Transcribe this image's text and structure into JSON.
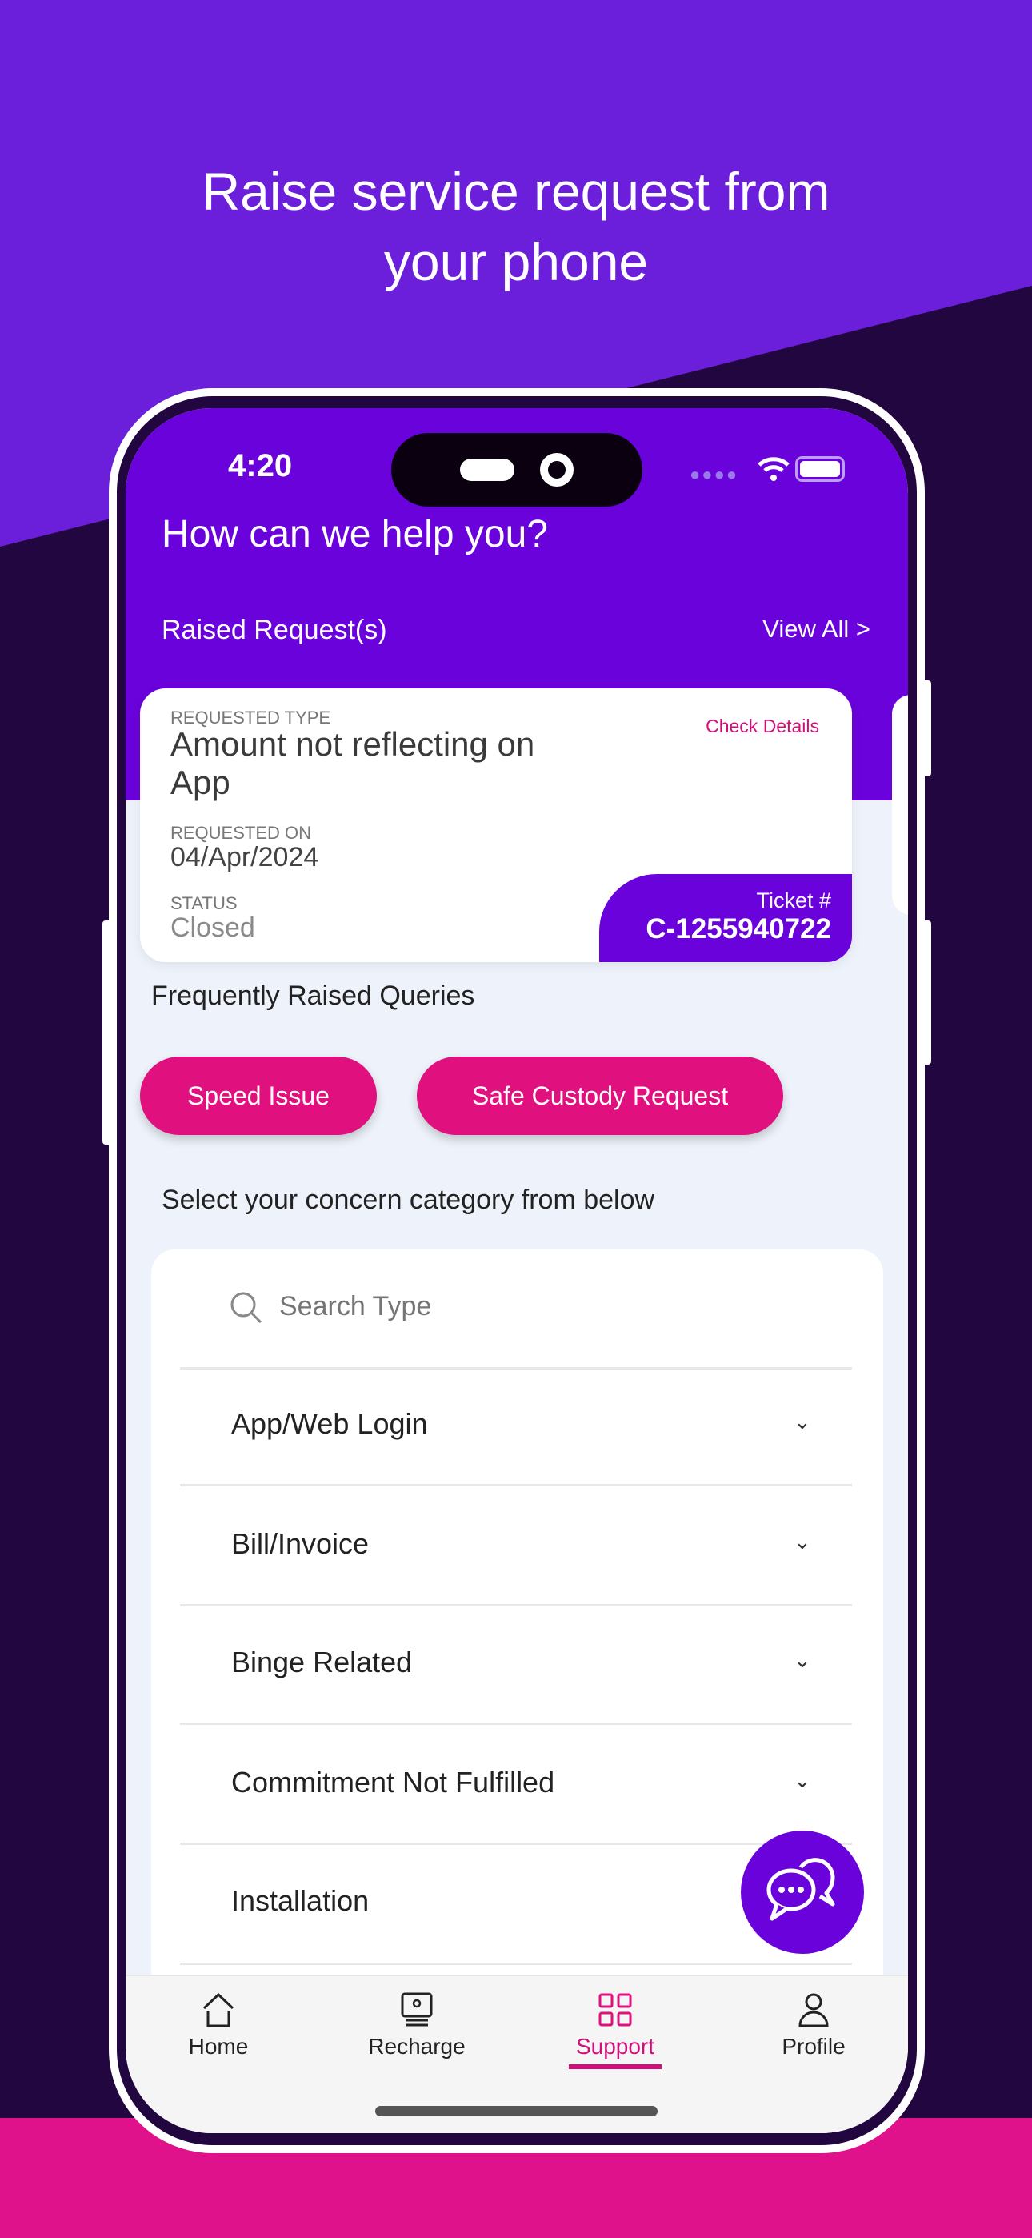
{
  "promo": {
    "line1": "Raise service request from",
    "line2": "your phone"
  },
  "status_bar": {
    "time": "4:20"
  },
  "header": {
    "title": "How can we help you?",
    "raised_label": "Raised Request(s)",
    "view_all": "View All >"
  },
  "request_card": {
    "type_label": "REQUESTED TYPE",
    "type_value": "Amount not reflecting on App",
    "check_details": "Check Details",
    "date_label": "REQUESTED ON",
    "date_value": "04/Apr/2024",
    "status_label": "STATUS",
    "status_value": "Closed",
    "ticket_label": "Ticket #",
    "ticket_value": "C-1255940722"
  },
  "frequent": {
    "title": "Frequently Raised Queries",
    "chips": [
      "Speed Issue",
      "Safe Custody Request"
    ]
  },
  "category": {
    "title": "Select your concern category from below",
    "search_placeholder": "Search Type",
    "items": [
      "App/Web Login",
      "Bill/Invoice",
      "Binge Related",
      "Commitment Not Fulfilled",
      "Installation"
    ]
  },
  "nav": {
    "items": [
      "Home",
      "Recharge",
      "Support",
      "Profile"
    ],
    "active": "Support"
  },
  "colors": {
    "brand_purple": "#6a03db",
    "accent_pink": "#e0117f",
    "dark_bg": "#22063f"
  }
}
